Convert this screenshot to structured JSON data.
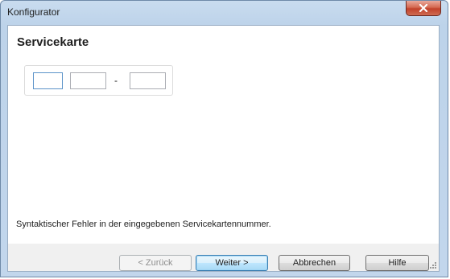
{
  "window": {
    "title": "Konfigurator"
  },
  "page": {
    "title": "Servicekarte"
  },
  "service_code": {
    "fields": [
      "",
      "",
      ""
    ],
    "separator": "-"
  },
  "status": {
    "error_message": "Syntaktischer Fehler in der eingegebenen Servicekartennummer."
  },
  "buttons": {
    "back_label": "< Zurück",
    "next_label": "Weiter >",
    "cancel_label": "Abbrechen",
    "help_label": "Hilfe"
  },
  "icons": {
    "close": "close-icon",
    "resize": "resize-grip-icon"
  },
  "colors": {
    "close_button": "#c1412a",
    "default_button_border": "#3c7fb1",
    "window_frame": "#bdd3ea"
  }
}
